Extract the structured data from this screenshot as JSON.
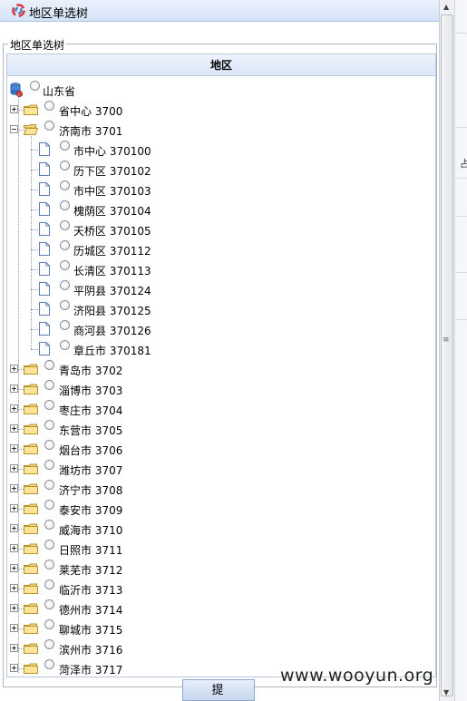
{
  "window": {
    "title": "地区单选树"
  },
  "fieldset": {
    "legend": "地区单选树"
  },
  "panel": {
    "header": "地区"
  },
  "tree": {
    "root": {
      "label": "山东省"
    },
    "cities": [
      {
        "label": "省中心 3700",
        "expanded": false
      },
      {
        "label": "济南市 3701",
        "expanded": true,
        "children": [
          "市中心 370100",
          "历下区 370102",
          "市中区 370103",
          "槐荫区 370104",
          "天桥区 370105",
          "历城区 370112",
          "长清区 370113",
          "平阴县 370124",
          "济阳县 370125",
          "商河县 370126",
          "章丘市 370181"
        ]
      },
      {
        "label": "青岛市 3702",
        "expanded": false
      },
      {
        "label": "淄博市 3703",
        "expanded": false
      },
      {
        "label": "枣庄市 3704",
        "expanded": false
      },
      {
        "label": "东营市 3705",
        "expanded": false
      },
      {
        "label": "烟台市 3706",
        "expanded": false
      },
      {
        "label": "潍坊市 3707",
        "expanded": false
      },
      {
        "label": "济宁市 3708",
        "expanded": false
      },
      {
        "label": "泰安市 3709",
        "expanded": false
      },
      {
        "label": "威海市 3710",
        "expanded": false
      },
      {
        "label": "日照市 3711",
        "expanded": false
      },
      {
        "label": "莱芜市 3712",
        "expanded": false
      },
      {
        "label": "临沂市 3713",
        "expanded": false
      },
      {
        "label": "德州市 3714",
        "expanded": false
      },
      {
        "label": "聊城市 3715",
        "expanded": false
      },
      {
        "label": "滨州市 3716",
        "expanded": false
      },
      {
        "label": "菏泽市 3717",
        "expanded": false
      }
    ]
  },
  "buttons": {
    "submit": "提交"
  },
  "watermark": "www.wooyun.org",
  "background_fragment": "占",
  "colors": {
    "folder": "#f3d77a",
    "header": "#dbe6f8",
    "titlebar": "#d4e3f7"
  }
}
